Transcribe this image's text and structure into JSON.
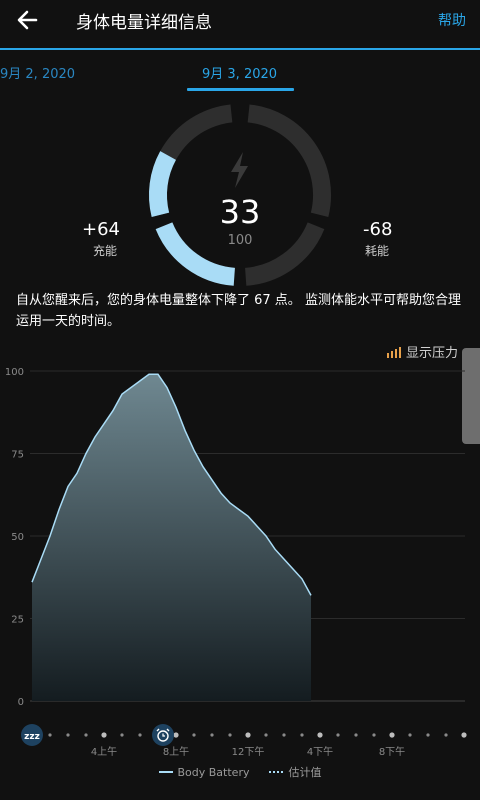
{
  "header": {
    "back_icon": "arrow-left-icon",
    "title": "身体电量详细信息",
    "help_label": "帮助"
  },
  "dates": {
    "previous": "9月 2, 2020",
    "current": "9月 3, 2020"
  },
  "gauge": {
    "value": "33",
    "max": "100",
    "level": 33,
    "icon": "lightning-icon",
    "charged_value": "+64",
    "charged_label": "充能",
    "drained_value": "-68",
    "drained_label": "耗能"
  },
  "summary": {
    "text": "自从您醒来后，您的身体电量整体下降了 67 点。 监测体能水平可帮助您合理运用一天的时间。"
  },
  "stress_toggle": {
    "label": "显示压力",
    "icon": "stress-bars-icon"
  },
  "colors": {
    "accent": "#2aa6e8",
    "gauge_fill": "#a9dcf6",
    "gauge_track": "#2e2e2e",
    "stress_icon": "#e8a14a"
  },
  "chart_data": {
    "type": "area",
    "y_ticks": [
      "100",
      "75",
      "50",
      "25",
      "0"
    ],
    "ylim": [
      0,
      100
    ],
    "x_ticks": [
      "4上午",
      "8上午",
      "12下午",
      "4下午",
      "8下午"
    ],
    "x_range_hours": [
      0,
      24
    ],
    "series": [
      {
        "name": "Body Battery",
        "x": [
          0,
          0.5,
          1,
          1.5,
          2,
          2.5,
          3,
          3.5,
          4,
          4.5,
          5,
          5.5,
          6,
          6.5,
          7,
          7.5,
          8,
          8.5,
          9,
          9.5,
          10,
          10.5,
          11,
          11.5,
          12,
          12.5,
          13,
          13.5,
          14,
          14.5,
          15,
          15.5
        ],
        "y": [
          36,
          43,
          50,
          58,
          65,
          69,
          75,
          80,
          84,
          88,
          93,
          95,
          97,
          99,
          99,
          95,
          89,
          82,
          76,
          71,
          67,
          63,
          60,
          58,
          56,
          53,
          50,
          46,
          43,
          40,
          37,
          32
        ]
      }
    ],
    "grid": true
  },
  "timeline": {
    "sleep_icon": "sleep-zzz-icon",
    "alarm_icon": "alarm-clock-icon"
  },
  "legend": {
    "series_label": "Body Battery",
    "estimate_label": "估计值"
  }
}
